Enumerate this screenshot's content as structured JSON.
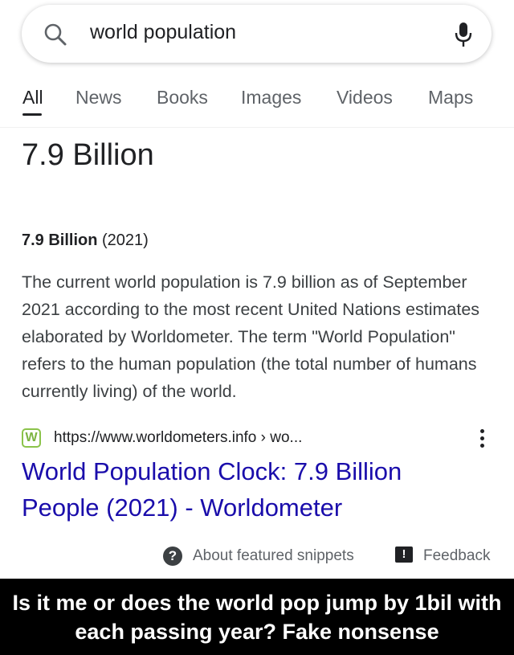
{
  "search": {
    "query": "world population",
    "icons": {
      "search": "search-icon",
      "mic": "mic-icon"
    }
  },
  "tabs": [
    {
      "label": "All",
      "active": true
    },
    {
      "label": "News"
    },
    {
      "label": "Books"
    },
    {
      "label": "Images"
    },
    {
      "label": "Videos"
    },
    {
      "label": "Maps"
    }
  ],
  "answer": {
    "headline": "7.9 Billion"
  },
  "snippet": {
    "bold": "7.9 Billion",
    "year": " (2021)",
    "body": "The current world population is 7.9 billion as of September 2021 according to the most recent United Nations estimates elaborated by Worldometer. The term \"World Population\" refers to the human population (the total number of humans currently living) of the world."
  },
  "source": {
    "favicon_letter": "W",
    "url": "https://www.worldometers.info › wo...",
    "title": "World Population Clock: 7.9 Billion People (2021) - Worldometer",
    "title_color": "#1a0dab"
  },
  "footer": {
    "about_label": "About featured snippets",
    "feedback_label": "Feedback"
  },
  "caption": {
    "text": "Is it me or does the world pop jump by 1bil with each passing year? Fake nonsense"
  }
}
